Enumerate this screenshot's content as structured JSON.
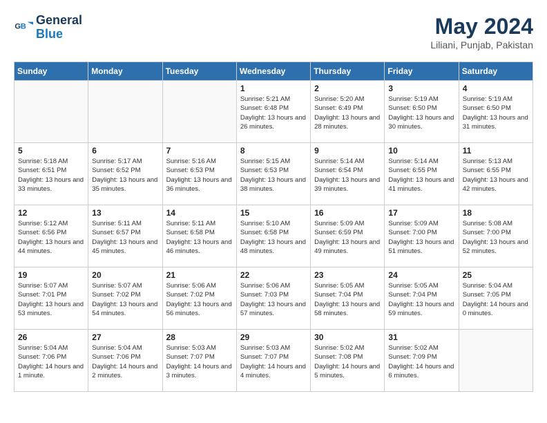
{
  "header": {
    "logo_line1": "General",
    "logo_line2": "Blue",
    "month_year": "May 2024",
    "location": "Liliani, Punjab, Pakistan"
  },
  "days_of_week": [
    "Sunday",
    "Monday",
    "Tuesday",
    "Wednesday",
    "Thursday",
    "Friday",
    "Saturday"
  ],
  "weeks": [
    [
      {
        "day": "",
        "sunrise": "",
        "sunset": "",
        "daylight": "",
        "empty": true
      },
      {
        "day": "",
        "sunrise": "",
        "sunset": "",
        "daylight": "",
        "empty": true
      },
      {
        "day": "",
        "sunrise": "",
        "sunset": "",
        "daylight": "",
        "empty": true
      },
      {
        "day": "1",
        "sunrise": "Sunrise: 5:21 AM",
        "sunset": "Sunset: 6:48 PM",
        "daylight": "Daylight: 13 hours and 26 minutes.",
        "empty": false
      },
      {
        "day": "2",
        "sunrise": "Sunrise: 5:20 AM",
        "sunset": "Sunset: 6:49 PM",
        "daylight": "Daylight: 13 hours and 28 minutes.",
        "empty": false
      },
      {
        "day": "3",
        "sunrise": "Sunrise: 5:19 AM",
        "sunset": "Sunset: 6:50 PM",
        "daylight": "Daylight: 13 hours and 30 minutes.",
        "empty": false
      },
      {
        "day": "4",
        "sunrise": "Sunrise: 5:19 AM",
        "sunset": "Sunset: 6:50 PM",
        "daylight": "Daylight: 13 hours and 31 minutes.",
        "empty": false
      }
    ],
    [
      {
        "day": "5",
        "sunrise": "Sunrise: 5:18 AM",
        "sunset": "Sunset: 6:51 PM",
        "daylight": "Daylight: 13 hours and 33 minutes.",
        "empty": false
      },
      {
        "day": "6",
        "sunrise": "Sunrise: 5:17 AM",
        "sunset": "Sunset: 6:52 PM",
        "daylight": "Daylight: 13 hours and 35 minutes.",
        "empty": false
      },
      {
        "day": "7",
        "sunrise": "Sunrise: 5:16 AM",
        "sunset": "Sunset: 6:53 PM",
        "daylight": "Daylight: 13 hours and 36 minutes.",
        "empty": false
      },
      {
        "day": "8",
        "sunrise": "Sunrise: 5:15 AM",
        "sunset": "Sunset: 6:53 PM",
        "daylight": "Daylight: 13 hours and 38 minutes.",
        "empty": false
      },
      {
        "day": "9",
        "sunrise": "Sunrise: 5:14 AM",
        "sunset": "Sunset: 6:54 PM",
        "daylight": "Daylight: 13 hours and 39 minutes.",
        "empty": false
      },
      {
        "day": "10",
        "sunrise": "Sunrise: 5:14 AM",
        "sunset": "Sunset: 6:55 PM",
        "daylight": "Daylight: 13 hours and 41 minutes.",
        "empty": false
      },
      {
        "day": "11",
        "sunrise": "Sunrise: 5:13 AM",
        "sunset": "Sunset: 6:55 PM",
        "daylight": "Daylight: 13 hours and 42 minutes.",
        "empty": false
      }
    ],
    [
      {
        "day": "12",
        "sunrise": "Sunrise: 5:12 AM",
        "sunset": "Sunset: 6:56 PM",
        "daylight": "Daylight: 13 hours and 44 minutes.",
        "empty": false
      },
      {
        "day": "13",
        "sunrise": "Sunrise: 5:11 AM",
        "sunset": "Sunset: 6:57 PM",
        "daylight": "Daylight: 13 hours and 45 minutes.",
        "empty": false
      },
      {
        "day": "14",
        "sunrise": "Sunrise: 5:11 AM",
        "sunset": "Sunset: 6:58 PM",
        "daylight": "Daylight: 13 hours and 46 minutes.",
        "empty": false
      },
      {
        "day": "15",
        "sunrise": "Sunrise: 5:10 AM",
        "sunset": "Sunset: 6:58 PM",
        "daylight": "Daylight: 13 hours and 48 minutes.",
        "empty": false
      },
      {
        "day": "16",
        "sunrise": "Sunrise: 5:09 AM",
        "sunset": "Sunset: 6:59 PM",
        "daylight": "Daylight: 13 hours and 49 minutes.",
        "empty": false
      },
      {
        "day": "17",
        "sunrise": "Sunrise: 5:09 AM",
        "sunset": "Sunset: 7:00 PM",
        "daylight": "Daylight: 13 hours and 51 minutes.",
        "empty": false
      },
      {
        "day": "18",
        "sunrise": "Sunrise: 5:08 AM",
        "sunset": "Sunset: 7:00 PM",
        "daylight": "Daylight: 13 hours and 52 minutes.",
        "empty": false
      }
    ],
    [
      {
        "day": "19",
        "sunrise": "Sunrise: 5:07 AM",
        "sunset": "Sunset: 7:01 PM",
        "daylight": "Daylight: 13 hours and 53 minutes.",
        "empty": false
      },
      {
        "day": "20",
        "sunrise": "Sunrise: 5:07 AM",
        "sunset": "Sunset: 7:02 PM",
        "daylight": "Daylight: 13 hours and 54 minutes.",
        "empty": false
      },
      {
        "day": "21",
        "sunrise": "Sunrise: 5:06 AM",
        "sunset": "Sunset: 7:02 PM",
        "daylight": "Daylight: 13 hours and 56 minutes.",
        "empty": false
      },
      {
        "day": "22",
        "sunrise": "Sunrise: 5:06 AM",
        "sunset": "Sunset: 7:03 PM",
        "daylight": "Daylight: 13 hours and 57 minutes.",
        "empty": false
      },
      {
        "day": "23",
        "sunrise": "Sunrise: 5:05 AM",
        "sunset": "Sunset: 7:04 PM",
        "daylight": "Daylight: 13 hours and 58 minutes.",
        "empty": false
      },
      {
        "day": "24",
        "sunrise": "Sunrise: 5:05 AM",
        "sunset": "Sunset: 7:04 PM",
        "daylight": "Daylight: 13 hours and 59 minutes.",
        "empty": false
      },
      {
        "day": "25",
        "sunrise": "Sunrise: 5:04 AM",
        "sunset": "Sunset: 7:05 PM",
        "daylight": "Daylight: 14 hours and 0 minutes.",
        "empty": false
      }
    ],
    [
      {
        "day": "26",
        "sunrise": "Sunrise: 5:04 AM",
        "sunset": "Sunset: 7:06 PM",
        "daylight": "Daylight: 14 hours and 1 minute.",
        "empty": false
      },
      {
        "day": "27",
        "sunrise": "Sunrise: 5:04 AM",
        "sunset": "Sunset: 7:06 PM",
        "daylight": "Daylight: 14 hours and 2 minutes.",
        "empty": false
      },
      {
        "day": "28",
        "sunrise": "Sunrise: 5:03 AM",
        "sunset": "Sunset: 7:07 PM",
        "daylight": "Daylight: 14 hours and 3 minutes.",
        "empty": false
      },
      {
        "day": "29",
        "sunrise": "Sunrise: 5:03 AM",
        "sunset": "Sunset: 7:07 PM",
        "daylight": "Daylight: 14 hours and 4 minutes.",
        "empty": false
      },
      {
        "day": "30",
        "sunrise": "Sunrise: 5:02 AM",
        "sunset": "Sunset: 7:08 PM",
        "daylight": "Daylight: 14 hours and 5 minutes.",
        "empty": false
      },
      {
        "day": "31",
        "sunrise": "Sunrise: 5:02 AM",
        "sunset": "Sunset: 7:09 PM",
        "daylight": "Daylight: 14 hours and 6 minutes.",
        "empty": false
      },
      {
        "day": "",
        "sunrise": "",
        "sunset": "",
        "daylight": "",
        "empty": true
      }
    ]
  ]
}
